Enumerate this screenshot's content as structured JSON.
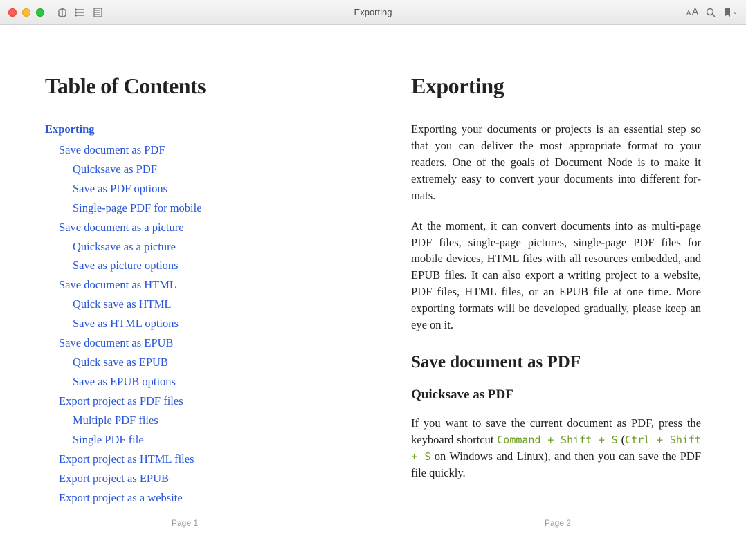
{
  "window": {
    "title": "Exporting"
  },
  "toc": {
    "heading": "Table of Contents",
    "items": [
      {
        "level": 1,
        "label": "Exporting"
      },
      {
        "level": 2,
        "label": "Save document as PDF"
      },
      {
        "level": 3,
        "label": "Quicksave as PDF"
      },
      {
        "level": 3,
        "label": "Save as PDF options"
      },
      {
        "level": 3,
        "label": "Single-page PDF for mobile"
      },
      {
        "level": 2,
        "label": "Save document as a picture"
      },
      {
        "level": 3,
        "label": "Quicksave as a picture"
      },
      {
        "level": 3,
        "label": "Save as picture options"
      },
      {
        "level": 2,
        "label": "Save document as HTML"
      },
      {
        "level": 3,
        "label": "Quick save as HTML"
      },
      {
        "level": 3,
        "label": "Save as HTML options"
      },
      {
        "level": 2,
        "label": "Save document as EPUB"
      },
      {
        "level": 3,
        "label": "Quick save as EPUB"
      },
      {
        "level": 3,
        "label": "Save as EPUB options"
      },
      {
        "level": 2,
        "label": "Export project as PDF files"
      },
      {
        "level": 3,
        "label": "Multiple PDF files"
      },
      {
        "level": 3,
        "label": "Single PDF file"
      },
      {
        "level": 2,
        "label": "Export project as HTML files"
      },
      {
        "level": 2,
        "label": "Export project as EPUB"
      },
      {
        "level": 2,
        "label": "Export project as a website"
      }
    ]
  },
  "article": {
    "heading": "Exporting",
    "para1": "Exporting your documents or projects is an essential step so that you can deliver the most appropriate format to your readers. One of the goals of Document Node is to make it extremely easy to convert your documents into different for­mats.",
    "para2": "At the moment, it can convert documents into as multi-page PDF files, single-page pictures, single-page PDF files for mobile devices, HTML files with all resources embedded, and EPUB files. It can also export a writing project to a website, PDF files, HTML files, or an EPUB file at one time. More exporting formats will be developed gradually, please keep an eye on it.",
    "h2": "Save document as PDF",
    "h3": "Quicksave as PDF",
    "para3_a": "If you want to save the current document as PDF, press the keyboard shortcut ",
    "code1": "Command + Shift + S",
    "para3_b": " (",
    "code2": "Ctrl + Shift + S",
    "para3_c": " on Windows and Linux), and then you can save the PDF file quickly."
  },
  "footer": {
    "page1": "Page 1",
    "page2": "Page 2"
  }
}
